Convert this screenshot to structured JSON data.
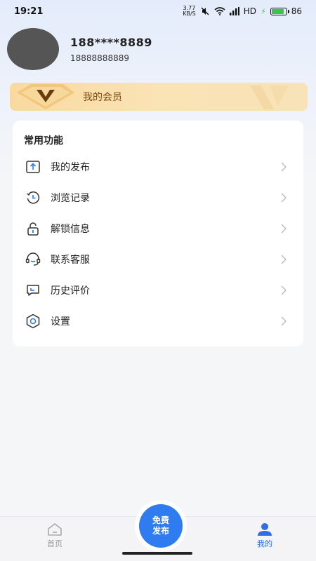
{
  "status_bar": {
    "time": "19:21",
    "net_speed_value": "3.77",
    "net_speed_unit": "KB/S",
    "network": "HD",
    "battery": "86"
  },
  "profile": {
    "name": "188****8889",
    "phone": "18888888889"
  },
  "vip": {
    "label": "我的会员"
  },
  "functions": {
    "title": "常用功能",
    "items": [
      {
        "label": "我的发布",
        "icon": "upload-icon"
      },
      {
        "label": "浏览记录",
        "icon": "history-icon"
      },
      {
        "label": "解锁信息",
        "icon": "unlock-icon"
      },
      {
        "label": "联系客服",
        "icon": "headset-icon"
      },
      {
        "label": "历史评价",
        "icon": "comment-icon"
      },
      {
        "label": "设置",
        "icon": "gear-icon"
      }
    ]
  },
  "tabbar": {
    "home_label": "首页",
    "publish_line1": "免费",
    "publish_line2": "发布",
    "mine_label": "我的"
  },
  "colors": {
    "accent": "#2f7bf0",
    "vip_gold": "#f9d9a0",
    "vip_text": "#7a4a12",
    "inactive_tab": "#999999"
  }
}
